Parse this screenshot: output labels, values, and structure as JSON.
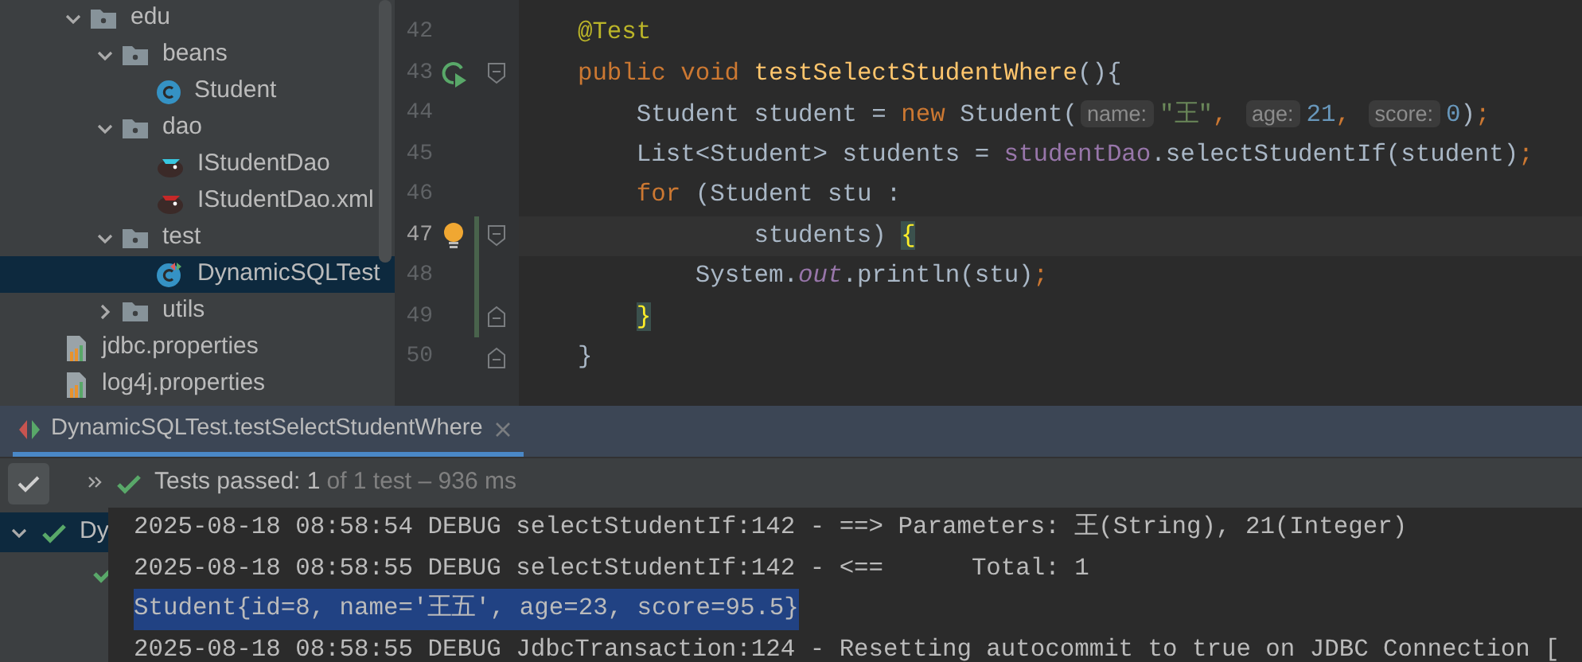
{
  "project_tree": {
    "items": [
      {
        "label": "edu",
        "kind": "folder",
        "expanded": true,
        "selected": false,
        "children": [
          {
            "label": "beans",
            "kind": "folder",
            "expanded": true,
            "selected": false,
            "children": [
              {
                "label": "Student",
                "kind": "class",
                "selected": false
              }
            ]
          },
          {
            "label": "dao",
            "kind": "folder",
            "expanded": true,
            "selected": false,
            "children": [
              {
                "label": "IStudentDao",
                "kind": "mapper",
                "selected": false
              },
              {
                "label": "IStudentDao.xml",
                "kind": "mapper-xml",
                "selected": false
              }
            ]
          },
          {
            "label": "test",
            "kind": "folder",
            "expanded": true,
            "selected": false,
            "children": [
              {
                "label": "DynamicSQLTest",
                "kind": "test-class",
                "selected": true
              }
            ]
          },
          {
            "label": "utils",
            "kind": "folder",
            "expanded": false,
            "selected": false
          }
        ]
      },
      {
        "label": "jdbc.properties",
        "kind": "properties",
        "selected": false
      },
      {
        "label": "log4j.properties",
        "kind": "properties",
        "selected": false
      }
    ]
  },
  "editor": {
    "lines": [
      {
        "number": "42",
        "current": false,
        "changed": false,
        "tokens": [
          {
            "kind": "annotation",
            "text": "    @Test"
          }
        ]
      },
      {
        "number": "43",
        "current": false,
        "changed": false,
        "run_icon": true,
        "fold_start": true,
        "tokens": [
          {
            "kind": "keyword",
            "text": "    public void "
          },
          {
            "kind": "method",
            "text": "testSelectStudentWhere"
          },
          {
            "kind": "plain",
            "text": "(){"
          }
        ]
      },
      {
        "number": "44",
        "current": false,
        "changed": false,
        "tokens": [
          {
            "kind": "plain",
            "text": "        Student student = "
          },
          {
            "kind": "keyword",
            "text": "new"
          },
          {
            "kind": "plain",
            "text": " Student("
          },
          {
            "kind": "hint",
            "text": "name:"
          },
          {
            "kind": "string",
            "text": "\"王\""
          },
          {
            "kind": "keyword",
            "text": ", "
          },
          {
            "kind": "hint",
            "text": "age:"
          },
          {
            "kind": "number",
            "text": "21"
          },
          {
            "kind": "keyword",
            "text": ", "
          },
          {
            "kind": "hint",
            "text": "score:"
          },
          {
            "kind": "number",
            "text": "0"
          },
          {
            "kind": "plain",
            "text": ")"
          },
          {
            "kind": "keyword",
            "text": ";"
          }
        ]
      },
      {
        "number": "45",
        "current": false,
        "changed": false,
        "tokens": [
          {
            "kind": "plain",
            "text": "        List<Student> students = "
          },
          {
            "kind": "field",
            "text": "studentDao"
          },
          {
            "kind": "plain",
            "text": ".selectStudentIf(student)"
          },
          {
            "kind": "keyword",
            "text": ";"
          }
        ]
      },
      {
        "number": "46",
        "current": false,
        "changed": false,
        "tokens": [
          {
            "kind": "keyword",
            "text": "        for"
          },
          {
            "kind": "plain",
            "text": " (Student stu :"
          }
        ]
      },
      {
        "number": "47",
        "current": true,
        "changed": true,
        "bulb_icon": true,
        "fold_start": true,
        "tokens": [
          {
            "kind": "plain",
            "text": "                students) "
          },
          {
            "kind": "brace",
            "text": "{"
          }
        ]
      },
      {
        "number": "48",
        "current": false,
        "changed": true,
        "tokens": [
          {
            "kind": "plain",
            "text": "            System."
          },
          {
            "kind": "static-field",
            "text": "out"
          },
          {
            "kind": "plain",
            "text": ".println(stu)"
          },
          {
            "kind": "keyword",
            "text": ";"
          }
        ]
      },
      {
        "number": "49",
        "current": false,
        "changed": true,
        "fold_end": true,
        "tokens": [
          {
            "kind": "brace",
            "text": "        }"
          }
        ]
      },
      {
        "number": "50",
        "current": false,
        "changed": false,
        "fold_end": true,
        "tokens": [
          {
            "kind": "plain",
            "text": "    }"
          }
        ]
      }
    ]
  },
  "run_panel": {
    "tabs": [
      {
        "label": "DynamicSQLTest.testSelectStudentWhere",
        "selected": true
      }
    ],
    "toolbar": {
      "status": "Tests passed: 1",
      "detail": "of 1 test – 936 ms",
      "passed": true
    },
    "test_tree": [
      {
        "label": "Dy",
        "passed": true,
        "expanded": true,
        "selected": true,
        "children": [
          {
            "passed": true
          }
        ]
      }
    ],
    "console": [
      {
        "text": "2025-08-18 08:58:54 DEBUG selectStudentIf:142 - ==> Parameters: 王(String), 21(Integer)",
        "selected": false
      },
      {
        "text": "2025-08-18 08:58:55 DEBUG selectStudentIf:142 - <==      Total: 1",
        "selected": false
      },
      {
        "text": "Student{id=8, name='王五', age=23, score=95.5}",
        "selected": true
      },
      {
        "text": "2025-08-18 08:58:55 DEBUG JdbcTransaction:124 - Resetting autocommit to true on JDBC Connection [",
        "selected": false
      }
    ]
  }
}
